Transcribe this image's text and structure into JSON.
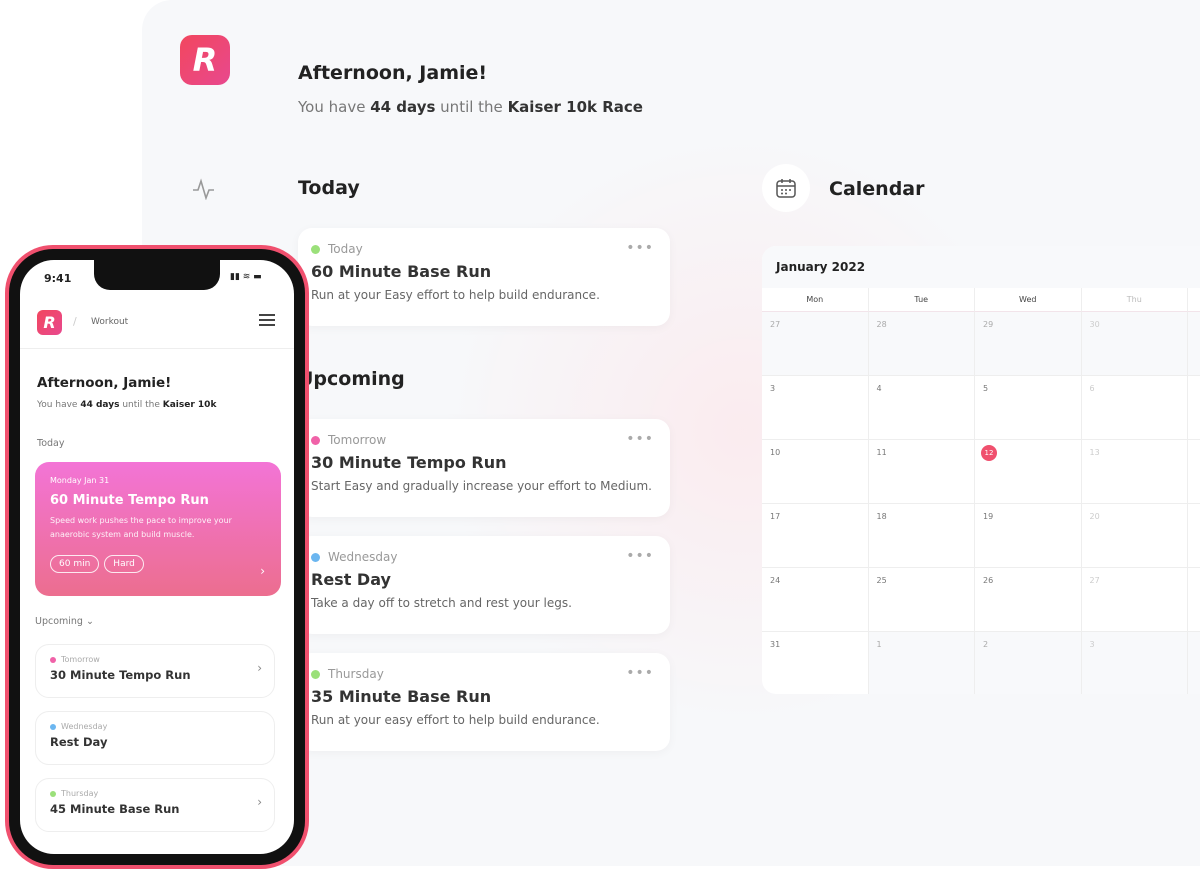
{
  "brand": {
    "logo_letter": "R",
    "accent": "#f0506e"
  },
  "desktop": {
    "greeting": "Afternoon, Jamie!",
    "subtitle": {
      "pre": "You have ",
      "days": "44 days",
      "mid": " until the ",
      "race": "Kaiser 10k Race"
    },
    "sidebar_icons": [
      "activity-icon",
      "calendar-icon"
    ],
    "today_heading": "Today",
    "upcoming_heading": "Upcoming",
    "today_card": {
      "when": "Today",
      "title": "60 Minute Base Run",
      "desc": "Run at your Easy effort to help build endurance.",
      "dot": "#9be07a"
    },
    "upcoming": [
      {
        "when": "Tomorrow",
        "title": "30 Minute Tempo Run",
        "desc": "Start Easy and gradually increase your effort to Medium.",
        "dot": "#f062a8"
      },
      {
        "when": "Wednesday",
        "title": "Rest Day",
        "desc": "Take a day off to stretch and rest your legs.",
        "dot": "#6bb6f0"
      },
      {
        "when": "Thursday",
        "title": "35 Minute Base Run",
        "desc": "Run at your easy effort to help build endurance.",
        "dot": "#9be07a"
      }
    ],
    "more_label": "•••"
  },
  "calendar": {
    "heading": "Calendar",
    "month": "January 2022",
    "days": [
      "Mon",
      "Tue",
      "Wed",
      "Thu"
    ],
    "weeks": [
      [
        "27",
        "28",
        "29",
        "30"
      ],
      [
        "3",
        "4",
        "5",
        "6"
      ],
      [
        "10",
        "11",
        "12",
        "13"
      ],
      [
        "17",
        "18",
        "19",
        "20"
      ],
      [
        "24",
        "25",
        "26",
        "27"
      ],
      [
        "31",
        "1",
        "2",
        "3"
      ]
    ],
    "today": "12"
  },
  "phone": {
    "time": "9:41",
    "breadcrumb": "Workout",
    "greeting": "Afternoon, Jamie!",
    "subtitle": {
      "pre": "You have ",
      "days": "44 days",
      "mid": " until the ",
      "race": "Kaiser 10k"
    },
    "today_label": "Today",
    "hero": {
      "date": "Monday Jan 31",
      "title": "60 Minute Tempo Run",
      "desc": "Speed work pushes the pace to improve your anaerobic system and build muscle.",
      "tags": [
        "60 min",
        "Hard"
      ]
    },
    "upcoming_label": "Upcoming",
    "upcoming": [
      {
        "when": "Tomorrow",
        "title": "30 Minute Tempo Run",
        "dot": "#f062a8"
      },
      {
        "when": "Wednesday",
        "title": "Rest Day",
        "dot": "#6bb6f0"
      },
      {
        "when": "Thursday",
        "title": "45 Minute Base Run",
        "dot": "#9be07a"
      }
    ]
  }
}
